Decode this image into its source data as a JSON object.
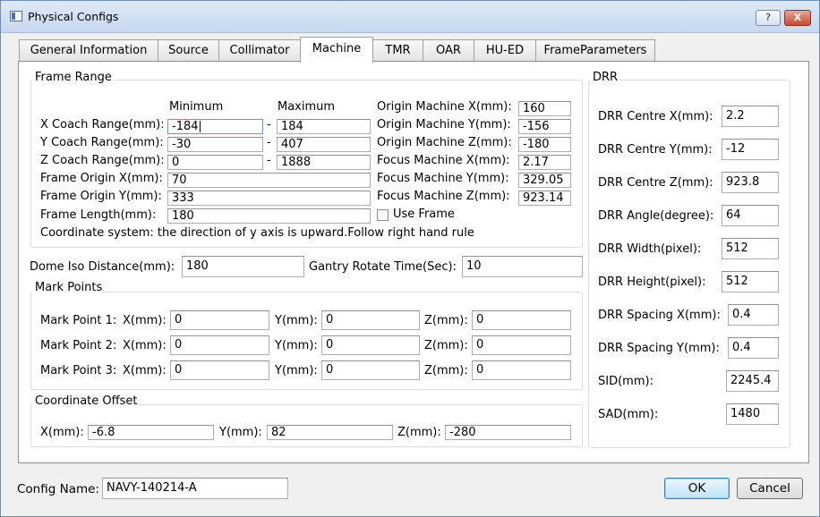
{
  "window": {
    "title": "Physical Configs",
    "help_label": "?",
    "close_label": "X"
  },
  "tabs": [
    "General Information",
    "Source",
    "Collimator",
    "Machine",
    "TMR",
    "OAR",
    "HU-ED",
    "FrameParameters"
  ],
  "frame_range": {
    "legend": "Frame Range",
    "min_header": "Minimum",
    "max_header": "Maximum",
    "dash": "-",
    "x_label": "X Coach Range(mm):",
    "x_min": "-184",
    "x_max": "184",
    "y_label": "Y Coach Range(mm):",
    "y_min": "-30",
    "y_max": "407",
    "z_label": "Z Coach Range(mm):",
    "z_min": "0",
    "z_max": "1888",
    "origin_x_label": "Frame Origin X(mm):",
    "origin_x": "70",
    "origin_y_label": "Frame Origin Y(mm):",
    "origin_y": "333",
    "length_label": "Frame Length(mm):",
    "length": "180",
    "use_frame_label": "Use Frame",
    "coord_note": "Coordinate system: the direction of y axis is upward.Follow right hand rule",
    "om_x_label": "Origin Machine X(mm):",
    "om_x": "160",
    "om_y_label": "Origin Machine Y(mm):",
    "om_y": "-156",
    "om_z_label": "Origin Machine Z(mm):",
    "om_z": "-180",
    "fm_x_label": "Focus Machine X(mm):",
    "fm_x": "2.17",
    "fm_y_label": "Focus Machine Y(mm):",
    "fm_y": "329.05",
    "fm_z_label": "Focus Machine Z(mm):",
    "fm_z": "923.14"
  },
  "dome": {
    "label": "Dome Iso Distance(mm):",
    "value": "180"
  },
  "gantry": {
    "label": "Gantry Rotate Time(Sec):",
    "value": "10"
  },
  "mark_points": {
    "legend": "Mark Points",
    "rows": [
      {
        "label": "Mark Point 1:",
        "x_label": "X(mm):",
        "x": "0",
        "y_label": "Y(mm):",
        "y": "0",
        "z_label": "Z(mm):",
        "z": "0"
      },
      {
        "label": "Mark Point 2:",
        "x_label": "X(mm):",
        "x": "0",
        "y_label": "Y(mm):",
        "y": "0",
        "z_label": "Z(mm):",
        "z": "0"
      },
      {
        "label": "Mark Point 3:",
        "x_label": "X(mm):",
        "x": "0",
        "y_label": "Y(mm):",
        "y": "0",
        "z_label": "Z(mm):",
        "z": "0"
      }
    ]
  },
  "coord_offset": {
    "legend": "Coordinate Offset",
    "x_label": "X(mm):",
    "x": "-6.8",
    "y_label": "Y(mm):",
    "y": "82",
    "z_label": "Z(mm):",
    "z": "-280"
  },
  "drr": {
    "legend": "DRR",
    "fields": [
      {
        "label": "DRR Centre X(mm):",
        "value": "2.2"
      },
      {
        "label": "DRR Centre Y(mm):",
        "value": "-12"
      },
      {
        "label": "DRR Centre Z(mm):",
        "value": "923.8"
      },
      {
        "label": "DRR Angle(degree):",
        "value": "64"
      },
      {
        "label": "DRR Width(pixel):",
        "value": "512"
      },
      {
        "label": "DRR Height(pixel):",
        "value": "512"
      },
      {
        "label": "DRR Spacing X(mm):",
        "value": "0.4"
      },
      {
        "label": "DRR Spacing Y(mm):",
        "value": "0.4"
      },
      {
        "label": "SID(mm):",
        "value": "2245.4"
      },
      {
        "label": "SAD(mm):",
        "value": "1480"
      }
    ]
  },
  "footer": {
    "config_label": "Config Name:",
    "config_value": "NAVY-140214-A",
    "ok_label": "OK",
    "cancel_label": "Cancel"
  }
}
